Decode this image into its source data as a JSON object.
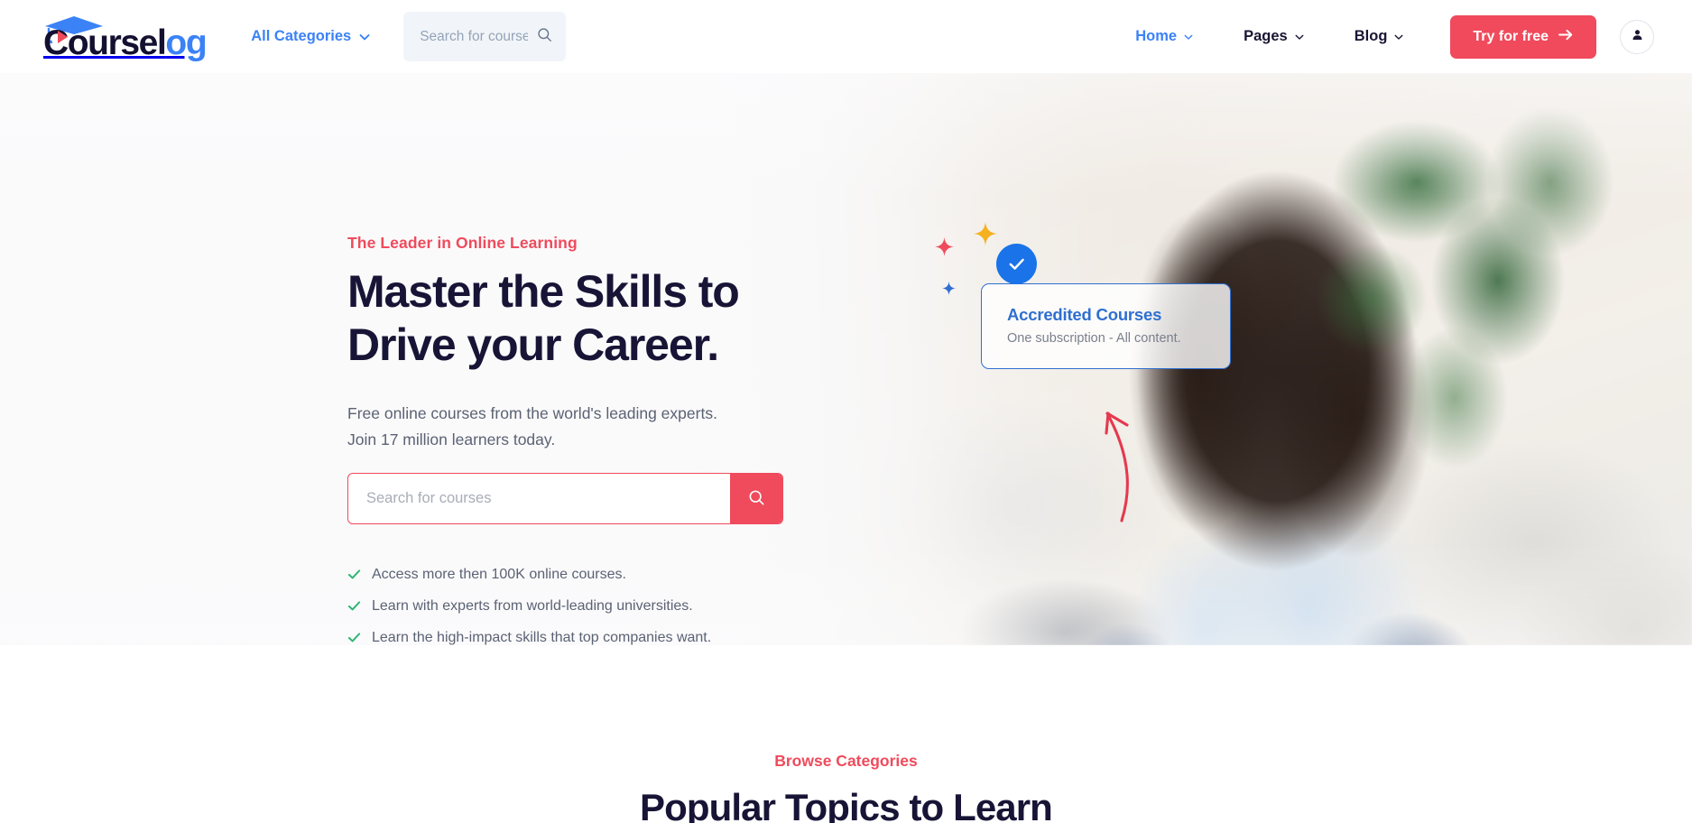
{
  "brand": {
    "name_dark": "Coursel",
    "name_blue": "og",
    "mark": "graduation-cap-logo",
    "accent_red": "#ef4b5c",
    "accent_blue": "#3b82f6",
    "headline_color": "#181436",
    "green": "#2bb673"
  },
  "header": {
    "categories_label": "All Categories",
    "search": {
      "placeholder": "Search for courses",
      "value": ""
    },
    "nav": [
      {
        "label": "Home",
        "has_caret": true,
        "active": true
      },
      {
        "label": "Pages",
        "has_caret": true,
        "active": false
      },
      {
        "label": "Blog",
        "has_caret": true,
        "active": false
      }
    ],
    "cta_label": "Try for free",
    "cta_arrow": "→",
    "account_icon": "user-icon"
  },
  "hero": {
    "eyebrow": "The Leader in Online Learning",
    "headline_line1": "Master the Skills to",
    "headline_line2": "Drive your Career.",
    "sub_line1": "Free online courses from the world's leading experts.",
    "sub_line2": "Join 17 million learners today.",
    "search": {
      "placeholder": "Search for courses",
      "value": "",
      "button_icon": "search-icon"
    },
    "checks": [
      "Access more then 100K online courses.",
      "Learn with experts from world-leading universities.",
      "Learn the high-impact skills that top companies want."
    ],
    "card": {
      "title": "Accredited Courses",
      "subtitle": "One subscription - All content.",
      "badge_icon": "check-badge-icon"
    },
    "decorations": {
      "sparkle_red": "#ef4b5c",
      "sparkle_yellow": "#f5b120",
      "sparkle_blue": "#2f6fd0",
      "arrow": "curved-arrow-up",
      "arrow_color": "#e5394f"
    }
  },
  "categories_section": {
    "eyebrow": "Browse Categories",
    "title": "Popular Topics to Learn"
  }
}
